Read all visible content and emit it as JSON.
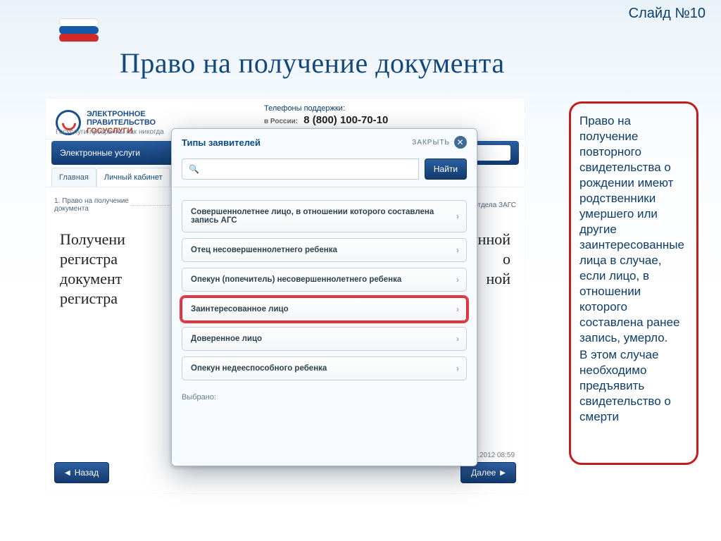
{
  "slide": {
    "number_label": "Слайд №10"
  },
  "title": "Право на получение документа",
  "portal": {
    "logo_line1": "ЭЛЕКТРОННОЕ",
    "logo_line2": "ПРАВИТЕЛЬСТВО",
    "logo_line3": "ГОСУСЛУГИ",
    "tagline": "Госуслуги прозрачны как никогда",
    "support_label": "Телефоны поддержки:",
    "support_prefix": "в России:",
    "support_phone": "8 (800) 100-70-10",
    "nav_item1": "Электронные услуги",
    "tab1": "Главная",
    "tab2": "Личный кабинет",
    "step_left": "1. Право на получение документа",
    "step_right": "6. Выбор отдела ЗАГС",
    "body_l1": "Получени",
    "body_l2": "регистра",
    "body_l3": "документ",
    "body_l4": "регистра",
    "body_r1": "твенной",
    "body_r2": "о",
    "body_r3": "ной",
    "back": "Назад",
    "next": "Далее",
    "draft_note": "Черновик заявления сохранен 10.08.2012 08:59"
  },
  "modal": {
    "title": "Типы заявителей",
    "close": "ЗАКРЫТЬ",
    "search_placeholder": "",
    "find": "Найти",
    "options": [
      "Совершеннолетнее лицо, в отношении которого составлена запись АГС",
      "Отец несовершеннолетнего ребенка",
      "Опекун (попечитель) несовершеннолетнего ребенка",
      "Заинтересованное лицо",
      "Доверенное лицо",
      "Опекун недееспособного ребенка"
    ],
    "highlight_index": 3,
    "selected_label": "Выбрано"
  },
  "callout": {
    "p1": "Право на получение повторного свидетельства о рождении  имеют родственники умершего или другие заинтересованные лица в случае, если лицо, в отношении которого составлена ранее запись, умерло.",
    "p2": "В этом случае необходимо предъявить свидетельство о смерти"
  }
}
